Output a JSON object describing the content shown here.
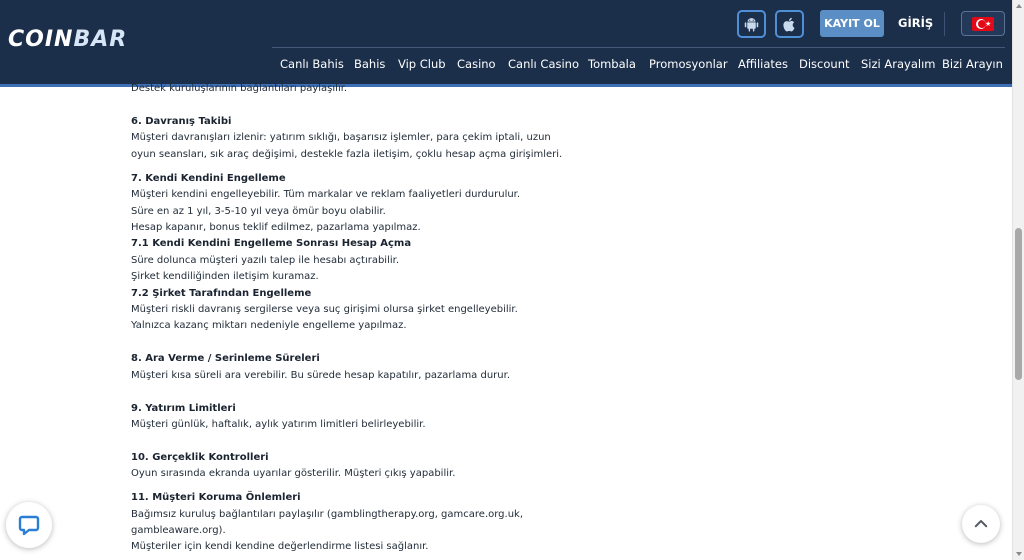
{
  "header": {
    "logo_part1": "COIN",
    "logo_part2": "BAR",
    "android_icon": "android-icon",
    "apple_icon": "apple-icon",
    "register_label": "KAYIT OL",
    "login_label": "GİRİŞ",
    "language_flag": "turkey-flag-icon"
  },
  "nav": {
    "items": [
      {
        "label": "Canlı Bahis"
      },
      {
        "label": "Bahis"
      },
      {
        "label": "Vip Club"
      },
      {
        "label": "Casino"
      },
      {
        "label": "Canlı Casino"
      },
      {
        "label": "Tombala"
      },
      {
        "label": "Promosyonlar"
      },
      {
        "label": "Affiliates"
      },
      {
        "label": "Discount"
      },
      {
        "label": "Sizi Arayalım"
      },
      {
        "label": "Bizi Arayın"
      }
    ]
  },
  "content": {
    "lines": [
      {
        "text": "Destek kuruluşlarının bağlantıları paylaşılır.",
        "bold": false
      },
      {
        "text": "6. Davranış Takibi",
        "bold": true
      },
      {
        "text": "Müşteri davranışları izlenir: yatırım sıklığı, başarısız işlemler, para çekim iptali, uzun",
        "bold": false
      },
      {
        "text": "oyun seansları, sık araç değişimi, destekle fazla iletişim, çoklu hesap açma girişimleri.",
        "bold": false
      },
      {
        "text": "7. Kendi Kendini Engelleme",
        "bold": true
      },
      {
        "text": "Müşteri kendini engelleyebilir. Tüm markalar ve reklam faaliyetleri durdurulur.",
        "bold": false
      },
      {
        "text": "Süre en az 1 yıl, 3-5-10 yıl veya ömür boyu olabilir.",
        "bold": false
      },
      {
        "text": "Hesap kapanır, bonus teklif edilmez, pazarlama yapılmaz.",
        "bold": false
      },
      {
        "text": "7.1 Kendi Kendini Engelleme Sonrası Hesap Açma",
        "bold": true
      },
      {
        "text": "Süre dolunca müşteri yazılı talep ile hesabı açtırabilir.",
        "bold": false
      },
      {
        "text": "Şirket kendiliğinden iletişim kuramaz.",
        "bold": false
      },
      {
        "text": "7.2 Şirket Tarafından Engelleme",
        "bold": true
      },
      {
        "text": "Müşteri riskli davranış sergilerse veya suç girişimi olursa şirket engelleyebilir.",
        "bold": false
      },
      {
        "text": "Yalnızca kazanç miktarı nedeniyle engelleme yapılmaz.",
        "bold": false
      },
      {
        "text": "8. Ara Verme / Serinleme Süreleri",
        "bold": true
      },
      {
        "text": "Müşteri kısa süreli ara verebilir. Bu sürede hesap kapatılır, pazarlama durur.",
        "bold": false
      },
      {
        "text": "9. Yatırım Limitleri",
        "bold": true
      },
      {
        "text": "Müşteri günlük, haftalık, aylık yatırım limitleri belirleyebilir.",
        "bold": false
      },
      {
        "text": "10. Gerçeklik Kontrolleri",
        "bold": true
      },
      {
        "text": "Oyun sırasında ekranda uyarılar gösterilir. Müşteri çıkış yapabilir.",
        "bold": false
      },
      {
        "text": "11. Müşteri Koruma Önlemleri",
        "bold": true
      },
      {
        "text": "Bağımsız kuruluş bağlantıları paylaşılır (gamblingtherapy.org, gamcare.org.uk,",
        "bold": false
      },
      {
        "text": "gambleaware.org).",
        "bold": false
      },
      {
        "text": "Müşteriler için kendi kendine değerlendirme listesi sağlanır.",
        "bold": false
      }
    ]
  },
  "widgets": {
    "chat_icon": "chat-bubble-icon",
    "scroll_top_icon": "chevron-up-icon"
  },
  "colors": {
    "header_bg": "#1b2e4a",
    "accent_blue": "#3d6fb6",
    "register_bg": "#5b8ec4"
  }
}
